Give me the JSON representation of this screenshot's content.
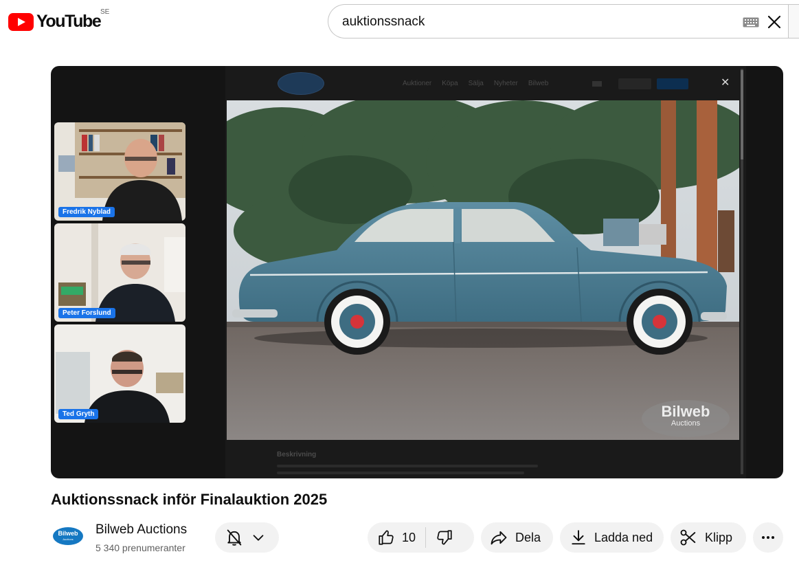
{
  "header": {
    "logo_text": "YouTube",
    "country_code": "SE",
    "search_value": "auktionssnack"
  },
  "player": {
    "site_nav_links": [
      "Auktioner",
      "Köpa",
      "Sälja",
      "Nyheter",
      "Bilweb"
    ],
    "watermark_main": "Bilweb",
    "watermark_sub": "Auctions",
    "description_heading": "Beskrivning",
    "participants": [
      {
        "name": "Fredrik Nyblad"
      },
      {
        "name": "Peter Forslund"
      },
      {
        "name": "Ted Gryth"
      }
    ],
    "label_color": "#1a73e8",
    "car_color": "#4e7f96"
  },
  "video": {
    "title": "Auktionssnack inför Finalauktion 2025"
  },
  "channel": {
    "name": "Bilweb Auctions",
    "subscribers": "5 340 prenumeranter",
    "avatar_text": "Bilweb",
    "avatar_subtext": "Auctions"
  },
  "actions": {
    "like_count": "10",
    "share_label": "Dela",
    "download_label": "Ladda ned",
    "clip_label": "Klipp"
  }
}
